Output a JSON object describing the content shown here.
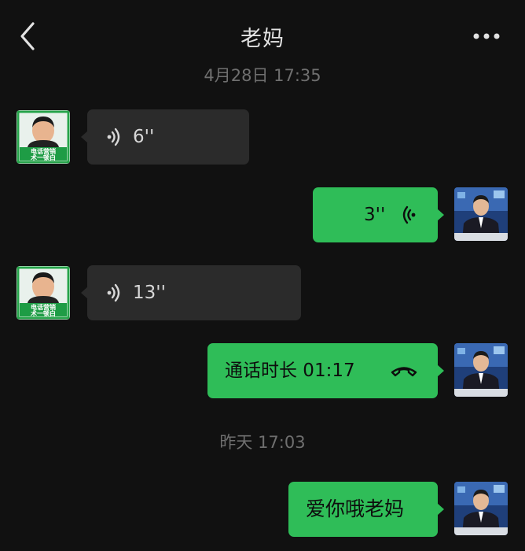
{
  "header": {
    "title": "老妈",
    "back_icon": "chevron-left-icon",
    "more_icon": "more-horizontal-icon"
  },
  "timestamps": [
    "4月28日 17:35",
    "昨天 17:03"
  ],
  "contact_avatar": {
    "caption_line1": "电话营销",
    "caption_line2": "术一顿白",
    "icon": "contact-avatar"
  },
  "self_avatar": {
    "icon": "self-avatar"
  },
  "messages": [
    {
      "direction": "incoming",
      "type": "voice",
      "text": "6''",
      "icon": "voice-wave-icon"
    },
    {
      "direction": "outgoing",
      "type": "voice",
      "text": "3''",
      "icon": "voice-wave-icon"
    },
    {
      "direction": "incoming",
      "type": "voice",
      "text": "13''",
      "icon": "voice-wave-icon"
    },
    {
      "direction": "outgoing",
      "type": "call",
      "text": "通话时长 01:17",
      "icon": "phone-hangup-icon"
    },
    {
      "direction": "outgoing",
      "type": "text",
      "text": "爱你哦老妈"
    }
  ],
  "colors": {
    "background": "#111111",
    "incoming_bubble": "#2b2b2b",
    "outgoing_bubble": "#2fbd58",
    "timestamp": "#6f6f6f"
  }
}
